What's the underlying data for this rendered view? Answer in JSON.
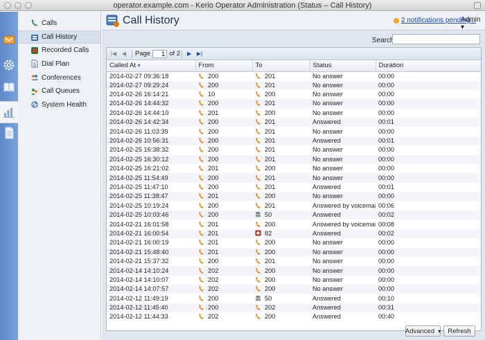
{
  "window": {
    "title": "operator.example.com - Kerio Operator Administration (Status – Call History)"
  },
  "iconbar": [
    {
      "name": "status-icon",
      "active": false
    },
    {
      "name": "settings-gear-icon",
      "active": false
    },
    {
      "name": "book-icon",
      "active": false
    },
    {
      "name": "bar-chart-icon",
      "active": true
    },
    {
      "name": "document-icon",
      "active": false
    }
  ],
  "sidebar": {
    "items": [
      {
        "label": "Calls",
        "icon": "phone-icon"
      },
      {
        "label": "Call History",
        "icon": "history-icon",
        "active": true
      },
      {
        "label": "Recorded Calls",
        "icon": "recording-icon"
      },
      {
        "label": "Dial Plan",
        "icon": "dial-plan-icon"
      },
      {
        "label": "Conferences",
        "icon": "conference-icon"
      },
      {
        "label": "Call Queues",
        "icon": "queue-icon"
      },
      {
        "label": "System Health",
        "icon": "health-icon"
      }
    ]
  },
  "header": {
    "title": "Call History",
    "notifications": "2 notifications pending...",
    "user": "Admin"
  },
  "search": {
    "label": "Search:",
    "value": ""
  },
  "pager": {
    "page_label": "Page",
    "page": "1",
    "of_label": "of 2"
  },
  "table": {
    "columns": [
      "Called At",
      "From",
      "To",
      "Status",
      "Duration"
    ],
    "rows": [
      {
        "called_at": "2014-02-27 09:36:18",
        "from": "200",
        "from_icon": "phone",
        "to": "201",
        "to_icon": "phone",
        "status": "No answer",
        "duration": "00:00"
      },
      {
        "called_at": "2014-02-27 09:29:24",
        "from": "200",
        "from_icon": "phone",
        "to": "201",
        "to_icon": "phone",
        "status": "No answer",
        "duration": "00:00"
      },
      {
        "called_at": "2014-02-26 16:14:21",
        "from": "10",
        "from_icon": "phone",
        "to": "200",
        "to_icon": "phone",
        "status": "No answer",
        "duration": "00:00"
      },
      {
        "called_at": "2014-02-26 14:44:32",
        "from": "200",
        "from_icon": "phone",
        "to": "201",
        "to_icon": "phone",
        "status": "No answer",
        "duration": "00:00"
      },
      {
        "called_at": "2014-02-26 14:44:10",
        "from": "201",
        "from_icon": "phone",
        "to": "200",
        "to_icon": "phone",
        "status": "No answer",
        "duration": "00:00"
      },
      {
        "called_at": "2014-02-26 14:42:34",
        "from": "200",
        "from_icon": "phone",
        "to": "201",
        "to_icon": "phone",
        "status": "Answered",
        "duration": "00:01"
      },
      {
        "called_at": "2014-02-26 11:03:39",
        "from": "200",
        "from_icon": "phone",
        "to": "201",
        "to_icon": "phone",
        "status": "No answer",
        "duration": "00:00"
      },
      {
        "called_at": "2014-02-26 10:56:31",
        "from": "200",
        "from_icon": "phone",
        "to": "201",
        "to_icon": "phone",
        "status": "Answered",
        "duration": "00:01"
      },
      {
        "called_at": "2014-02-25 16:38:32",
        "from": "200",
        "from_icon": "phone",
        "to": "201",
        "to_icon": "phone",
        "status": "No answer",
        "duration": "00:00"
      },
      {
        "called_at": "2014-02-25 16:30:12",
        "from": "200",
        "from_icon": "phone",
        "to": "201",
        "to_icon": "phone",
        "status": "No answer",
        "duration": "00:00"
      },
      {
        "called_at": "2014-02-25 16:21:02",
        "from": "201",
        "from_icon": "phone",
        "to": "200",
        "to_icon": "phone",
        "status": "No answer",
        "duration": "00:00"
      },
      {
        "called_at": "2014-02-25 11:54:49",
        "from": "200",
        "from_icon": "phone",
        "to": "201",
        "to_icon": "phone",
        "status": "No answer",
        "duration": "00:00"
      },
      {
        "called_at": "2014-02-25 11:47:10",
        "from": "200",
        "from_icon": "phone",
        "to": "201",
        "to_icon": "phone",
        "status": "Answered",
        "duration": "00:01"
      },
      {
        "called_at": "2014-02-25 11:38:47",
        "from": "201",
        "from_icon": "phone",
        "to": "200",
        "to_icon": "phone",
        "status": "No answer",
        "duration": "00:00"
      },
      {
        "called_at": "2014-02-25 10:19:24",
        "from": "200",
        "from_icon": "phone",
        "to": "201",
        "to_icon": "phone",
        "status": "Answered by voicemail",
        "duration": "00:06"
      },
      {
        "called_at": "2014-02-25 10:03:46",
        "from": "200",
        "from_icon": "phone",
        "to": "50",
        "to_icon": "conference",
        "status": "Answered",
        "duration": "00:02"
      },
      {
        "called_at": "2014-02-21 16:01:58",
        "from": "201",
        "from_icon": "phone",
        "to": "200",
        "to_icon": "phone",
        "status": "Answered by voicemail",
        "duration": "00:08"
      },
      {
        "called_at": "2014-02-21 16:00:54",
        "from": "201",
        "from_icon": "phone",
        "to": "82",
        "to_icon": "record",
        "status": "Answered",
        "duration": "00:02"
      },
      {
        "called_at": "2014-02-21 16:00:19",
        "from": "201",
        "from_icon": "phone",
        "to": "200",
        "to_icon": "phone",
        "status": "No answer",
        "duration": "00:00"
      },
      {
        "called_at": "2014-02-21 15:48:40",
        "from": "201",
        "from_icon": "phone",
        "to": "200",
        "to_icon": "phone",
        "status": "No answer",
        "duration": "00:00"
      },
      {
        "called_at": "2014-02-21 15:37:32",
        "from": "200",
        "from_icon": "phone",
        "to": "201",
        "to_icon": "phone",
        "status": "No answer",
        "duration": "00:00"
      },
      {
        "called_at": "2014-02-14 14:10:24",
        "from": "202",
        "from_icon": "phone",
        "to": "200",
        "to_icon": "phone",
        "status": "No answer",
        "duration": "00:00"
      },
      {
        "called_at": "2014-02-14 14:10:07",
        "from": "202",
        "from_icon": "phone",
        "to": "200",
        "to_icon": "phone",
        "status": "No answer",
        "duration": "00:00"
      },
      {
        "called_at": "2014-02-14 14:07:57",
        "from": "202",
        "from_icon": "phone",
        "to": "200",
        "to_icon": "phone",
        "status": "No answer",
        "duration": "00:00"
      },
      {
        "called_at": "2014-02-12 11:49:19",
        "from": "200",
        "from_icon": "phone",
        "to": "50",
        "to_icon": "conference",
        "status": "Answered",
        "duration": "00:10"
      },
      {
        "called_at": "2014-02-12 11:45:40",
        "from": "200",
        "from_icon": "phone",
        "to": "202",
        "to_icon": "phone",
        "status": "Answered",
        "duration": "00:31"
      },
      {
        "called_at": "2014-02-12 11:44:33",
        "from": "202",
        "from_icon": "phone",
        "to": "200",
        "to_icon": "phone",
        "status": "Answered",
        "duration": "00:40"
      }
    ]
  },
  "footer": {
    "advanced_label": "Advanced",
    "refresh_label": "Refresh"
  },
  "colors": {
    "accent": "#1f49b5",
    "phone_icon": "#e07b12",
    "notification_badge": "#f3a32b"
  }
}
